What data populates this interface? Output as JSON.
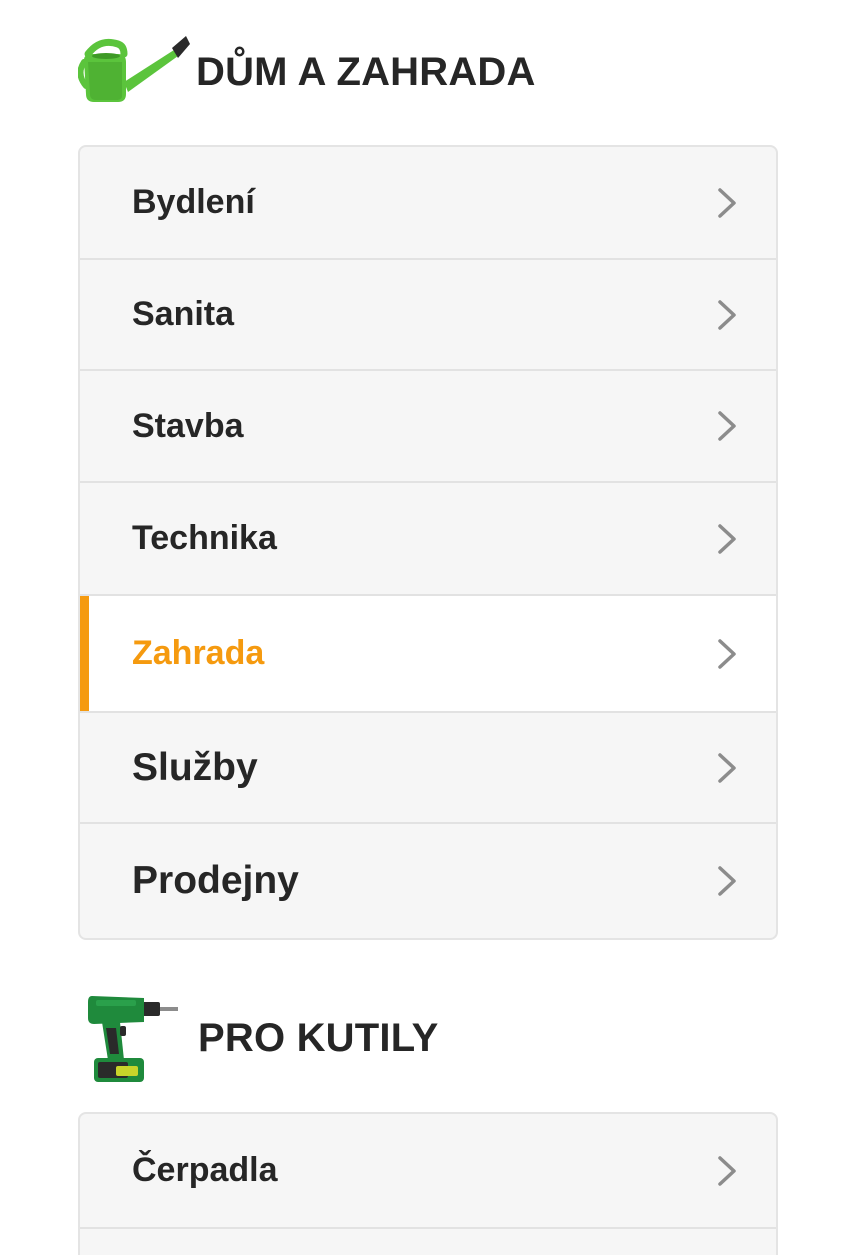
{
  "sections": [
    {
      "title": "DŮM A ZAHRADA",
      "icon": "watering-can-icon",
      "items": [
        {
          "label": "Bydlení",
          "active": false
        },
        {
          "label": "Sanita",
          "active": false
        },
        {
          "label": "Stavba",
          "active": false
        },
        {
          "label": "Technika",
          "active": false
        },
        {
          "label": "Zahrada",
          "active": true
        },
        {
          "label": "Služby",
          "active": false
        },
        {
          "label": "Prodejny",
          "active": false
        }
      ]
    },
    {
      "title": "PRO KUTILY",
      "icon": "cordless-drill-icon",
      "items": [
        {
          "label": "Čerpadla",
          "active": false
        }
      ]
    }
  ],
  "colors": {
    "accent": "#f59a0f",
    "text": "#262626",
    "menu_bg": "#f6f6f6",
    "active_bg": "#ffffff",
    "chevron": "#8c8c8c",
    "icon_green": "#5bc43c"
  }
}
